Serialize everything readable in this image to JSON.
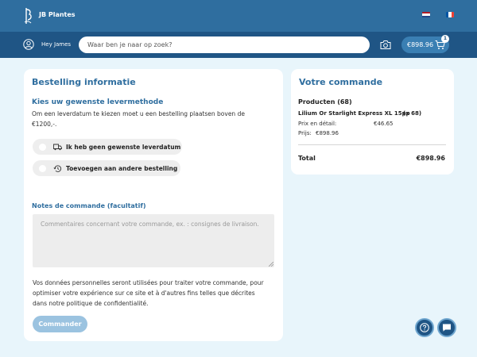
{
  "header": {
    "brand": "JB Plantes"
  },
  "search": {
    "greeting": "Hey James",
    "placeholder": "Waar ben je naar op zoek?",
    "cart_total": "€898.96",
    "cart_count": "1"
  },
  "order_info": {
    "title": "Bestelling informatie",
    "delivery_title": "Kies uw gewenste levermethode",
    "delivery_hint": "Om een leverdatum te kiezen moet u een bestelling plaatsen boven de €1200,-.",
    "options": [
      {
        "label": "Ik heb geen gewenste leverdatum",
        "icon": "truck-icon"
      },
      {
        "label": "Toevoegen aan andere bestelling",
        "icon": "history-icon"
      }
    ],
    "notes_label": "Notes de commande (facultatif)",
    "notes_placeholder": "Commentaires concernant votre commande, ex. : consignes de livraison.",
    "privacy": "Vos données personnelles seront utilisées pour traiter votre commande, pour optimiser votre expérience sur ce site et à d'autres fins telles que décrites dans notre politique de confidentialité.",
    "order_button": "Commander"
  },
  "summary": {
    "title": "Votre commande",
    "products_heading": "Producten (68)",
    "product_name": "Lilium Or Starlight Express XL 15pp",
    "product_qty": "(x 68)",
    "retail_label": "Prix en détail:",
    "retail_value": "€46.65",
    "price_label": "Prijs:",
    "price_value": "€898.96",
    "total_label": "Total",
    "total_value": "€898.96"
  },
  "colors": {
    "primary": "#1f5585",
    "accent": "#2f6e9f",
    "button_disabled": "#9bc3e0",
    "background": "#e8f5fb"
  }
}
